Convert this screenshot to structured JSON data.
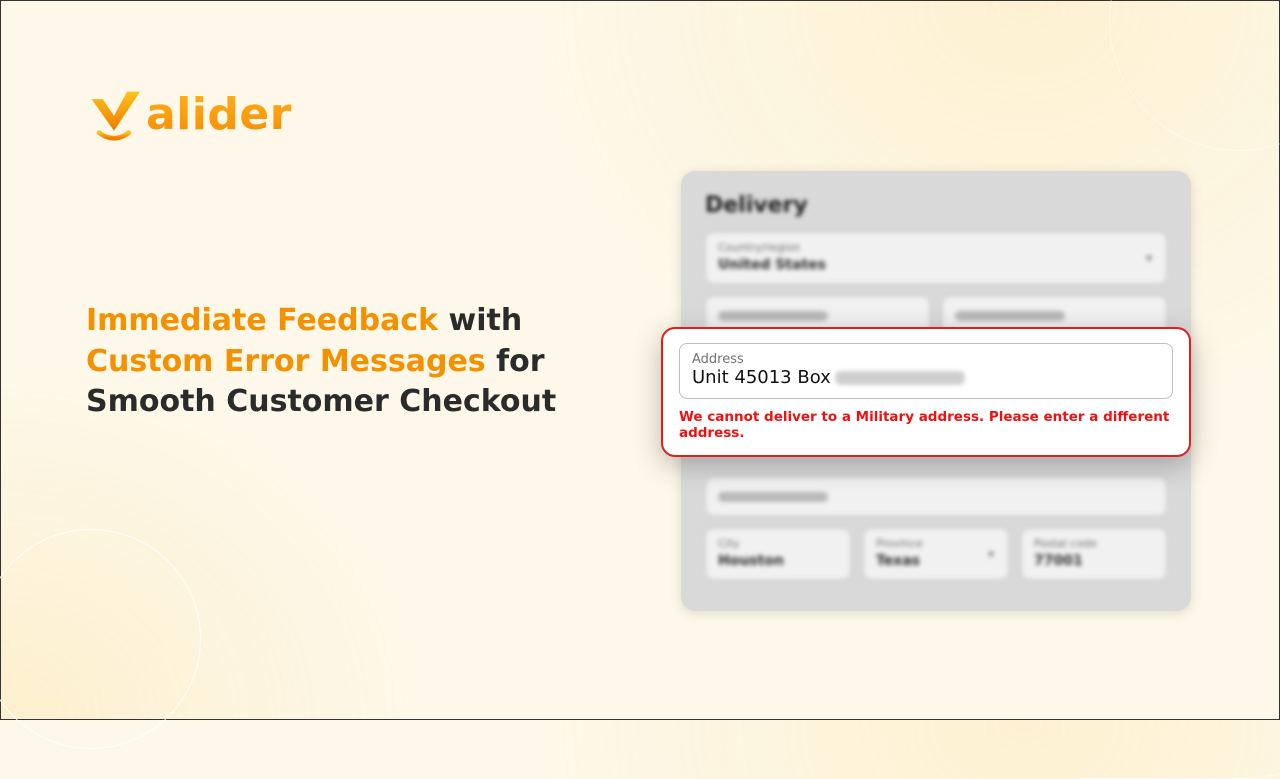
{
  "brand": {
    "name": "alider"
  },
  "headline": {
    "part1": "Immediate Feedback",
    "part2": " with ",
    "part3": "Custom Error Messages",
    "part4": " for Smooth Customer Checkout"
  },
  "card": {
    "title": "Delivery",
    "country": {
      "label": "Country/region",
      "value": "United States"
    },
    "city": {
      "label": "City",
      "value": "Houston"
    },
    "province": {
      "label": "Province",
      "value": "Texas"
    },
    "postal": {
      "label": "Postal code",
      "value": "77001"
    }
  },
  "focus": {
    "label": "Address",
    "value": "Unit 45013 Box",
    "error": "We cannot deliver to a Military address. Please enter a different address."
  }
}
